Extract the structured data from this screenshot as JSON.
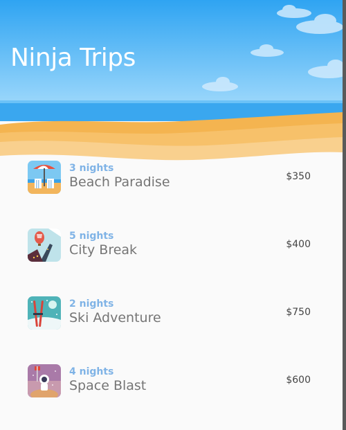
{
  "app": {
    "title": "Ninja Trips"
  },
  "colors": {
    "sky": "#4db3f5",
    "sand": "#f7c06a",
    "nights_text": "#7fb3e6",
    "name_text": "#757575"
  },
  "trips": [
    {
      "nights": "3 nights",
      "name": "Beach Paradise",
      "price": "$350",
      "icon": "beach-umbrella-icon"
    },
    {
      "nights": "5 nights",
      "name": "City Break",
      "price": "$400",
      "icon": "hot-air-balloon-icon"
    },
    {
      "nights": "2 nights",
      "name": "Ski Adventure",
      "price": "$750",
      "icon": "skis-icon"
    },
    {
      "nights": "4 nights",
      "name": "Space Blast",
      "price": "$600",
      "icon": "astronaut-icon"
    }
  ]
}
